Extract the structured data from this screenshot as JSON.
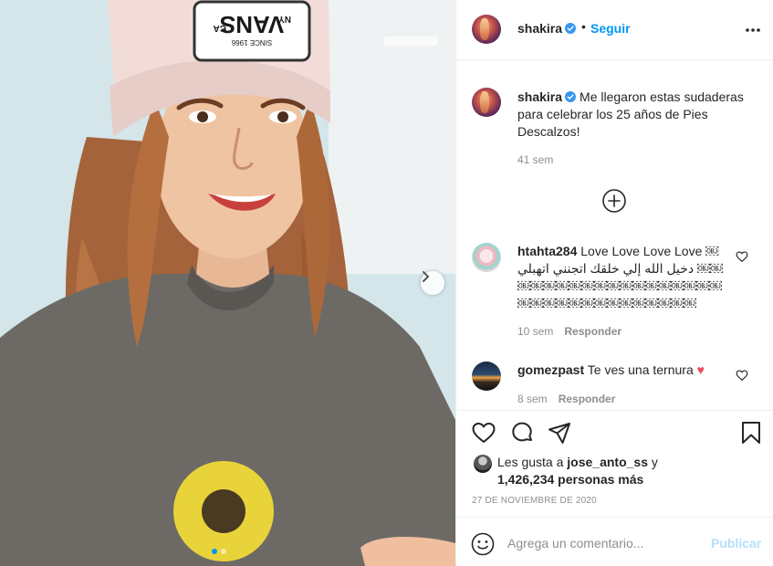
{
  "post": {
    "author": "shakira",
    "follow_separator": "•",
    "follow_label": "Seguir",
    "photo_hat_text": {
      "brand": "VANS",
      "left": "CA",
      "right": "NY",
      "since": "SINCE 1966"
    }
  },
  "caption": {
    "username": "shakira",
    "text": "Me llegaron estas sudaderas para celebrar los 25 años de Pies Descalzos!",
    "time": "41 sem"
  },
  "comments": [
    {
      "username": "htahta284",
      "text": "Love Love Love Love  ￼ دخيل الله إلي خلقك اتجنني اتهبلي ￼￼￼￼￼￼￼￼￼￼￼￼￼￼￼￼￼￼￼￼￼￼￼￼￼￼￼￼￼￼￼￼",
      "time": "10 sem",
      "reply_label": "Responder"
    },
    {
      "username": "gomezpast",
      "text": "Te ves una ternura",
      "emoji": "♥",
      "time": "8 sem",
      "reply_label": "Responder"
    }
  ],
  "likes": {
    "prefix": "Les gusta a ",
    "user": "jose_anto_ss",
    "conjunction": " y",
    "count": "1,426,234 personas más"
  },
  "date": "27 DE NOVIEMBRE DE 2020",
  "composer": {
    "placeholder": "Agrega un comentario...",
    "publish_label": "Publicar"
  },
  "carousel": {
    "total_slides": 2,
    "active_slide": 1
  },
  "colors": {
    "accent": "#0095f6",
    "publish_disabled": "#b2dffc",
    "secondary_text": "#8e8e8e",
    "heart_red": "#ed4956"
  }
}
